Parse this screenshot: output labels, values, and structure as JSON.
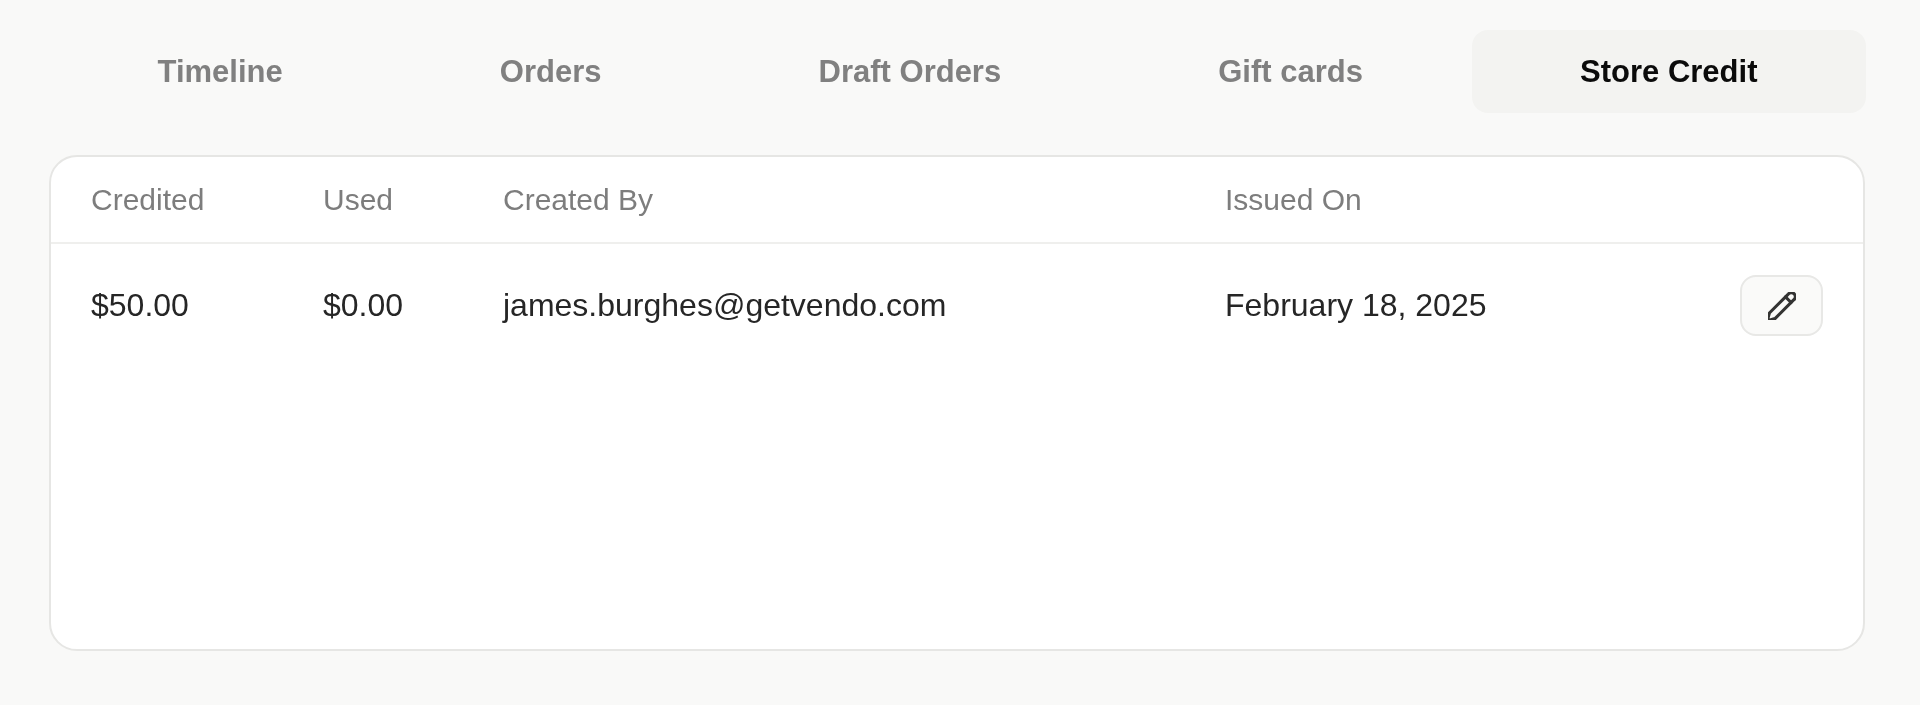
{
  "tabs": [
    {
      "label": "Timeline",
      "selected": false
    },
    {
      "label": "Orders",
      "selected": false
    },
    {
      "label": "Draft Orders",
      "selected": false
    },
    {
      "label": "Gift cards",
      "selected": false
    },
    {
      "label": "Store Credit",
      "selected": true
    }
  ],
  "table": {
    "columns": [
      "Credited",
      "Used",
      "Created By",
      "Issued On"
    ],
    "rows": [
      {
        "cells": [
          "$50.00",
          "$0.00",
          "james.burghes@getvendo.com",
          "February 18, 2025"
        ],
        "actions": [
          {
            "kind": "edit"
          }
        ]
      }
    ]
  }
}
